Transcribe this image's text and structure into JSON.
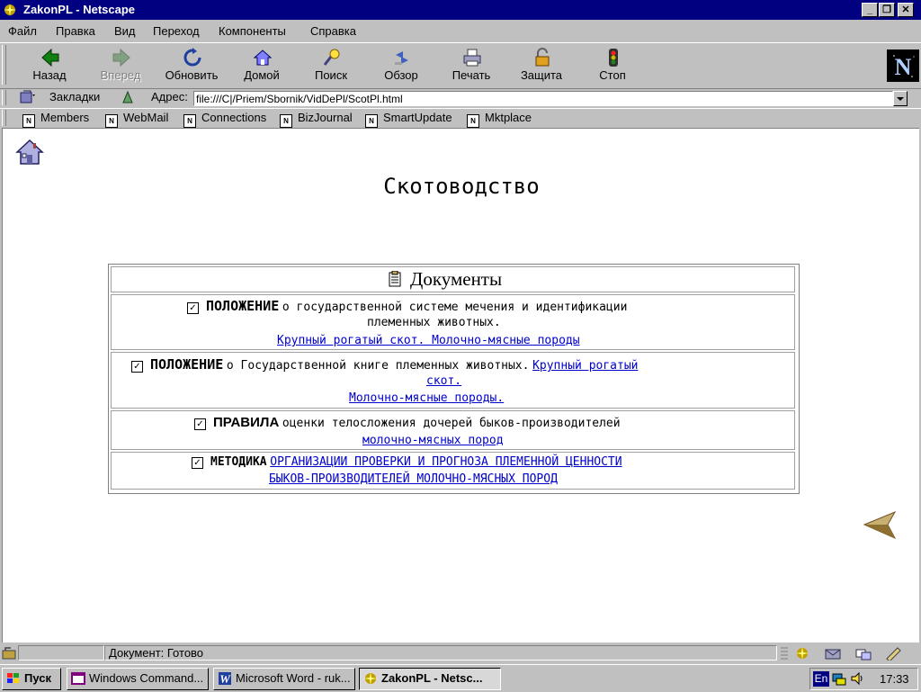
{
  "window": {
    "title": "ZakonPL - Netscape"
  },
  "menu": [
    "Файл",
    "Правка",
    "Вид",
    "Переход",
    "Компоненты",
    "Справка"
  ],
  "toolbar": {
    "back": "Назад",
    "forward": "Вперед",
    "reload": "Обновить",
    "home": "Домой",
    "search": "Поиск",
    "guide": "Обзор",
    "print": "Печать",
    "security": "Защита",
    "stop": "Стоп"
  },
  "location": {
    "bookmarks_label": "Закладки",
    "address_label": "Адрес:",
    "url": "file:///C|/Priem/Sbornik/VidDePl/ScotPl.html"
  },
  "personal_toolbar": [
    "Members",
    "WebMail",
    "Connections",
    "BizJournal",
    "SmartUpdate",
    "Mktplace"
  ],
  "page": {
    "heading": "Скотоводство",
    "table_title": "Документы",
    "docs": [
      {
        "keyword": "ПОЛОЖЕНИЕ",
        "text1": "о государственной системе мечения и идентификации",
        "text2": "племенных животных.",
        "link": "Крупный рогатый скот. Молочно-мясные породы"
      },
      {
        "keyword": "ПОЛОЖЕНИЕ",
        "text1": "о Государственной книге племенных животных.",
        "link1": "Крупный рогатый",
        "link2": "скот.",
        "link3": "Молочно-мясные  породы."
      },
      {
        "keyword": "ПРАВИЛА",
        "text1": "оценки телосложения дочерей быков-производителей",
        "link": "молочно-мясных пород"
      },
      {
        "keyword": "МЕТОДИКА",
        "link1": "ОРГАНИЗАЦИИ ПРОВЕРКИ И ПРОГНОЗА ПЛЕМЕННОЙ ЦЕННОСТИ",
        "link2": "БЫКОВ-ПРОИЗВОДИТЕЛЕЙ МОЛОЧНО-МЯСНЫХ ПОРОД"
      }
    ]
  },
  "status": {
    "text": "Документ: Готово"
  },
  "taskbar": {
    "start": "Пуск",
    "tasks": [
      "Windows Command...",
      "Microsoft Word - ruk...",
      "ZakonPL - Netsc..."
    ],
    "lang": "En",
    "clock": "17:33"
  }
}
